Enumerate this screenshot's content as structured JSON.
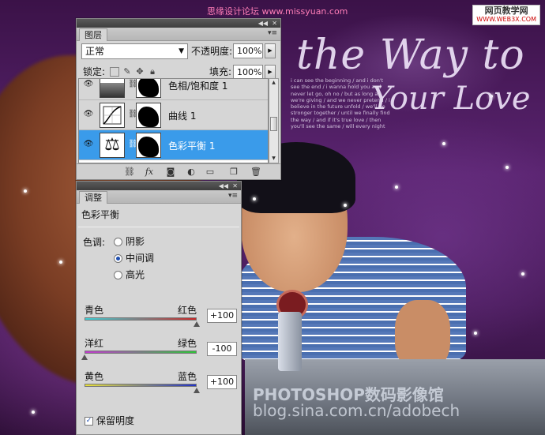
{
  "background": {
    "site_title": "思缘设计论坛 www.missyuan.com",
    "site_logo_line1": "网页教学网",
    "site_logo_line2": "WWW.WEB3X.COM",
    "script_line1": "the Way to",
    "script_line2": "Your Love",
    "poem": "i can see the beginning / and i don't see the end / i wanna hold you and never let go, oh no / but as long as we're giving / and we never pretend / i believe in the future unfold / we'll be stronger together / until we finally find the way / and if it's true love / then you'll see the same / will every night",
    "watermark_line1": "PHOTOSHOP数码影像馆",
    "watermark_line2": "blog.sina.com.cn/adobech"
  },
  "layers_panel": {
    "collapse_icon": "double-chevron-left-icon",
    "close_icon": "close-icon",
    "tab_label": "图层",
    "menu_icon": "panel-menu-icon",
    "blend_mode": "正常",
    "opacity_label": "不透明度:",
    "opacity_value": "100%",
    "lock_label": "锁定:",
    "fill_label": "填充:",
    "fill_value": "100%",
    "layers": [
      {
        "name": "色相/饱和度 1",
        "visible": true,
        "selected": false,
        "thumb_icon": "hue-saturation-icon"
      },
      {
        "name": "曲线 1",
        "visible": true,
        "selected": false,
        "thumb_icon": "curves-icon"
      },
      {
        "name": "色彩平衡 1",
        "visible": true,
        "selected": true,
        "thumb_icon": "color-balance-icon"
      }
    ],
    "selected_color": "#3a9bea"
  },
  "adjust_panel": {
    "tab_label": "调整",
    "title": "色彩平衡",
    "tone_label": "色调:",
    "tones": [
      {
        "label": "阴影",
        "selected": false
      },
      {
        "label": "中间调",
        "selected": true
      },
      {
        "label": "高光",
        "selected": false
      }
    ],
    "sliders": [
      {
        "left": "青色",
        "right": "红色",
        "value": "+100",
        "level": 100,
        "min": -100,
        "max": 100
      },
      {
        "left": "洋红",
        "right": "绿色",
        "value": "-100",
        "level": -100,
        "min": -100,
        "max": 100
      },
      {
        "left": "黄色",
        "right": "蓝色",
        "value": "+100",
        "level": 100,
        "min": -100,
        "max": 100
      }
    ],
    "preserve_label": "保留明度",
    "preserve_checked": true
  }
}
